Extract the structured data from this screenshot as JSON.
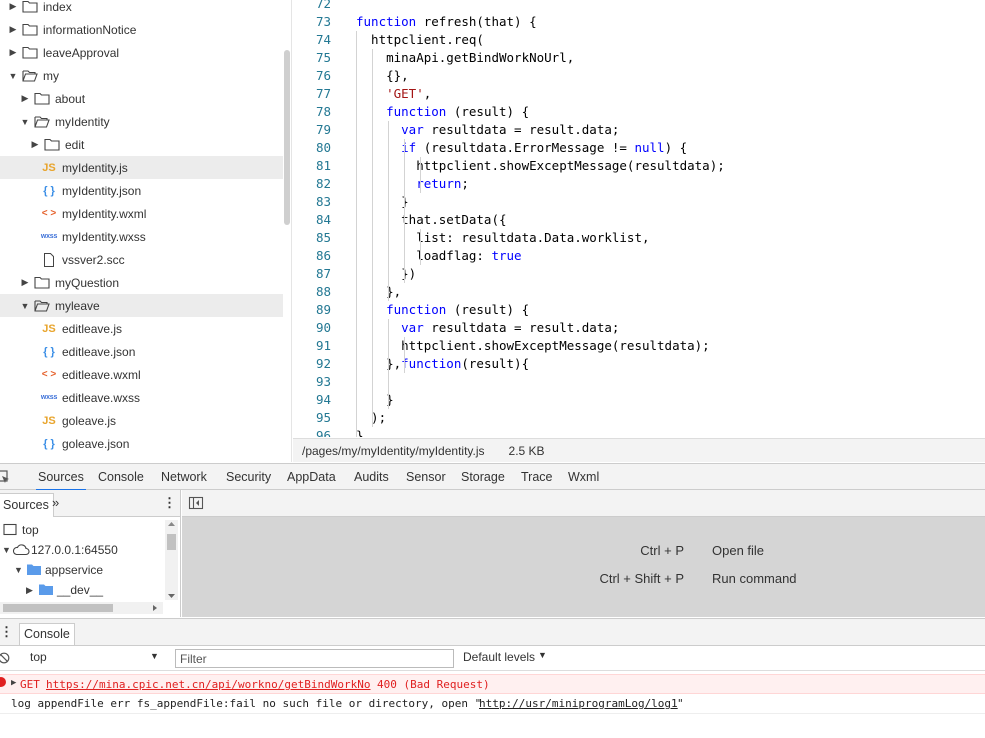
{
  "file_tree": {
    "items": [
      {
        "label": "index",
        "type": "folder",
        "expanded": false
      },
      {
        "label": "informationNotice",
        "type": "folder",
        "expanded": false
      },
      {
        "label": "leaveApproval",
        "type": "folder",
        "expanded": false
      },
      {
        "label": "my",
        "type": "folder",
        "expanded": true
      },
      {
        "label": "about",
        "type": "folder",
        "expanded": false
      },
      {
        "label": "myIdentity",
        "type": "folder",
        "expanded": true
      },
      {
        "label": "edit",
        "type": "folder",
        "expanded": false
      },
      {
        "label": "myIdentity.js",
        "type": "js",
        "selected": true
      },
      {
        "label": "myIdentity.json",
        "type": "json"
      },
      {
        "label": "myIdentity.wxml",
        "type": "wxml"
      },
      {
        "label": "myIdentity.wxss",
        "type": "wxss"
      },
      {
        "label": "vssver2.scc",
        "type": "file"
      },
      {
        "label": "myQuestion",
        "type": "folder",
        "expanded": false
      },
      {
        "label": "myleave",
        "type": "folder",
        "expanded": true
      },
      {
        "label": "editleave.js",
        "type": "js"
      },
      {
        "label": "editleave.json",
        "type": "json"
      },
      {
        "label": "editleave.wxml",
        "type": "wxml"
      },
      {
        "label": "editleave.wxss",
        "type": "wxss"
      },
      {
        "label": "goleave.js",
        "type": "js"
      },
      {
        "label": "goleave.json",
        "type": "json"
      }
    ],
    "icon_labels": {
      "js": "JS",
      "json": "{ }",
      "wxml": "< >",
      "wxss": "wxss"
    }
  },
  "editor": {
    "lines": [
      {
        "n": "72",
        "code": ""
      },
      {
        "n": "73",
        "code": "function refresh(that) {"
      },
      {
        "n": "74",
        "code": "  httpclient.req("
      },
      {
        "n": "75",
        "code": "    minaApi.getBindWorkNoUrl,"
      },
      {
        "n": "76",
        "code": "    {},"
      },
      {
        "n": "77",
        "code": "    'GET',"
      },
      {
        "n": "78",
        "code": "    function (result) {"
      },
      {
        "n": "79",
        "code": "      var resultdata = result.data;"
      },
      {
        "n": "80",
        "code": "      if (resultdata.ErrorMessage != null) {"
      },
      {
        "n": "81",
        "code": "        httpclient.showExceptMessage(resultdata);"
      },
      {
        "n": "82",
        "code": "        return;"
      },
      {
        "n": "83",
        "code": "      }"
      },
      {
        "n": "84",
        "code": "      that.setData({"
      },
      {
        "n": "85",
        "code": "        list: resultdata.Data.worklist,"
      },
      {
        "n": "86",
        "code": "        loadflag: true"
      },
      {
        "n": "87",
        "code": "      })"
      },
      {
        "n": "88",
        "code": "    },"
      },
      {
        "n": "89",
        "code": "    function (result) {"
      },
      {
        "n": "90",
        "code": "      var resultdata = result.data;"
      },
      {
        "n": "91",
        "code": "      httpclient.showExceptMessage(resultdata);"
      },
      {
        "n": "92",
        "code": "    },function(result){"
      },
      {
        "n": "93",
        "code": ""
      },
      {
        "n": "94",
        "code": "    }"
      },
      {
        "n": "95",
        "code": "  );"
      },
      {
        "n": "96",
        "code": "}"
      }
    ],
    "keywords": [
      "function",
      "var",
      "if",
      "null",
      "return",
      "true"
    ]
  },
  "file_status": {
    "path": "/pages/my/myIdentity/myIdentity.js",
    "size": "2.5 KB"
  },
  "devtools": {
    "tabs": [
      "Sources",
      "Console",
      "Network",
      "Security",
      "AppData",
      "Audits",
      "Sensor",
      "Storage",
      "Trace",
      "Wxml"
    ],
    "active_tab": "Sources"
  },
  "sources_nav": {
    "tab_label": "Sources",
    "more": "»",
    "tree": [
      {
        "label": "top",
        "icon": "frame-icon"
      },
      {
        "label": "127.0.0.1:64550",
        "icon": "cloud-icon"
      },
      {
        "label": "appservice",
        "icon": "folder-icon"
      },
      {
        "label": "__dev__",
        "icon": "folder-icon"
      }
    ]
  },
  "sources_main": {
    "shortcuts": [
      {
        "keys": "Ctrl + P",
        "action": "Open file"
      },
      {
        "keys": "Ctrl + Shift + P",
        "action": "Run command"
      }
    ]
  },
  "console": {
    "drawer_tab": "Console",
    "context": "top",
    "filter_placeholder": "Filter",
    "levels": "Default levels",
    "messages": {
      "error": {
        "method": "GET",
        "url": "https://mina.cpic.net.cn/api/workno/getBindWorkNo",
        "status": "400 (Bad Request)"
      },
      "log": {
        "prefix": "log appendFile err fs_appendFile:fail no such file or directory, open \"",
        "url": "http://usr/miniprogramLog/log1",
        "suffix": "\""
      }
    }
  },
  "colors": {
    "accent": "#1a73e8",
    "error": "#e02020",
    "line_number": "#237893",
    "keyword": "#0000ff",
    "string": "#a31515"
  }
}
